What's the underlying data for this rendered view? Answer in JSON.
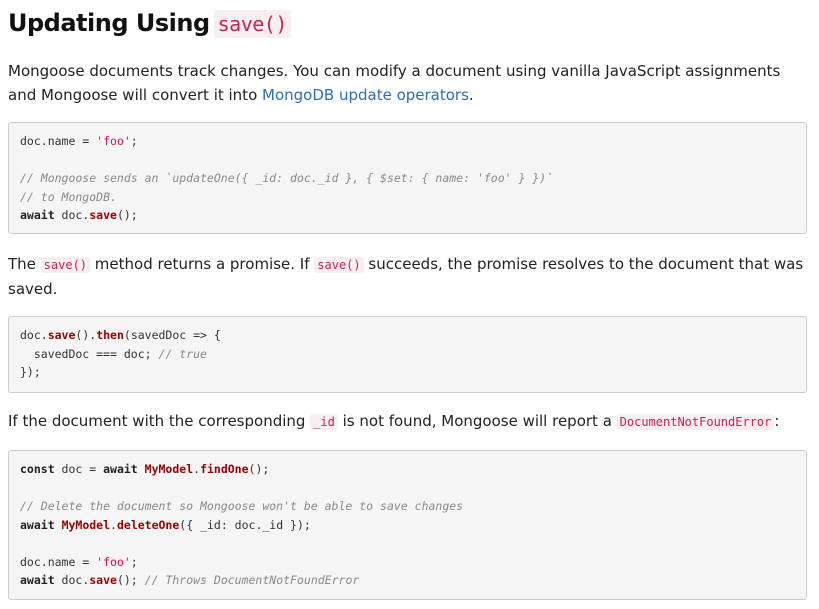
{
  "heading": {
    "text": "Updating Using",
    "code": "save()"
  },
  "para1": {
    "text_before": "Mongoose documents track changes. You can modify a document using vanilla JavaScript assignments and Mongoose will convert it into ",
    "link": "MongoDB update operators",
    "text_after": "."
  },
  "code1": {
    "l1_a": "doc.name = ",
    "l1_str": "'foo'",
    "l1_b": ";",
    "l3": "// Mongoose sends an `updateOne({ _id: doc._id }, { $set: { name: 'foo' } })`",
    "l4": "// to MongoDB.",
    "l5_kw": "await",
    "l5_a": " doc.",
    "l5_fn": "save",
    "l5_b": "();"
  },
  "para2": {
    "t1": "The ",
    "c1": "save()",
    "t2": " method returns a promise. If ",
    "c2": "save()",
    "t3": " succeeds, the promise resolves to the document that was saved."
  },
  "code2": {
    "l1_a": "doc.",
    "l1_fn": "save",
    "l1_b": "().",
    "l1_fn2": "then",
    "l1_c": "(savedDoc => {",
    "l2_a": "  savedDoc === doc; ",
    "l2_com": "// true",
    "l3": "});"
  },
  "para3": {
    "t1": "If the document with the corresponding ",
    "c1": "_id",
    "t2": " is not found, Mongoose will report a ",
    "c2": "DocumentNotFoundError",
    "t3": ":"
  },
  "code3": {
    "l1_kw": "const",
    "l1_a": " doc = ",
    "l1_kw2": "await",
    "l1_sp": " ",
    "l1_cls": "MyModel",
    "l1_dot": ".",
    "l1_fn": "findOne",
    "l1_b": "();",
    "l3": "// Delete the document so Mongoose won't be able to save changes",
    "l4_kw": "await",
    "l4_sp": " ",
    "l4_cls": "MyModel",
    "l4_dot": ".",
    "l4_fn": "deleteOne",
    "l4_b": "({ _id: doc._id });",
    "l6_a": "doc.name = ",
    "l6_str": "'foo'",
    "l6_b": ";",
    "l7_kw": "await",
    "l7_a": " doc.",
    "l7_fn": "save",
    "l7_b": "(); ",
    "l7_com": "// Throws DocumentNotFoundError"
  },
  "colors": {
    "inline_code": "#c7254e",
    "link": "#2a6ebb",
    "code_bg": "#f5f5f5"
  }
}
